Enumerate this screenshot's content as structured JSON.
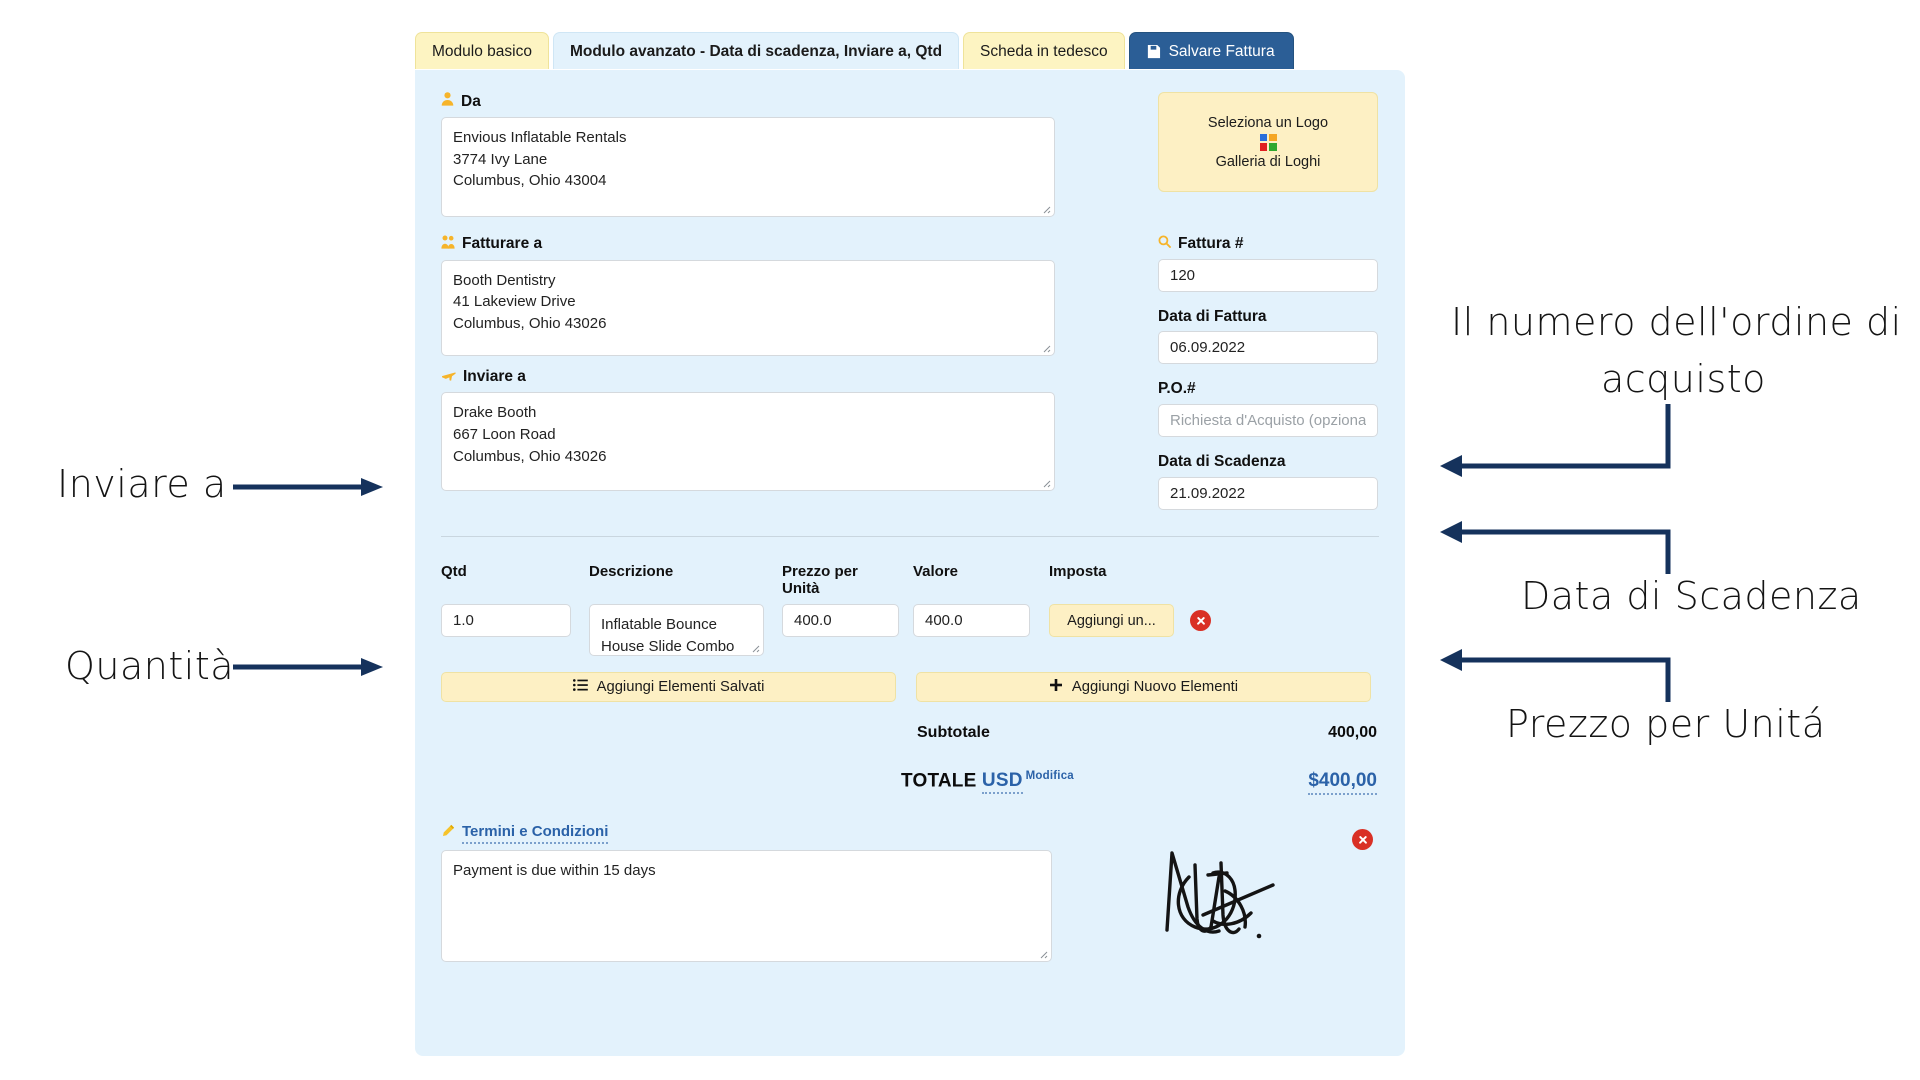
{
  "tabs": [
    {
      "label": "Modulo basico",
      "state": "inactive",
      "icon": null
    },
    {
      "label": "Modulo avanzato - Data di scadenza, Inviare a, Qtd",
      "state": "active",
      "icon": null
    },
    {
      "label": "Scheda in tedesco",
      "state": "inactive",
      "icon": null
    },
    {
      "label": "Salvare Fattura",
      "state": "primary",
      "icon": "save-disk-icon"
    }
  ],
  "form": {
    "from": {
      "icon": "person-icon",
      "label": "Da",
      "value": "Envious Inflatable Rentals\n3774 Ivy Lane\nColumbus, Ohio 43004"
    },
    "bill_to": {
      "icon": "people-icon",
      "label": "Fatturare a",
      "value": "Booth Dentistry\n41 Lakeview Drive\nColumbus, Ohio 43026"
    },
    "ship_to": {
      "icon": "airplane-icon",
      "label": "Inviare a",
      "value": "Drake Booth\n667 Loon Road\nColumbus, Ohio 43026"
    },
    "logo": {
      "title": "Seleziona un Logo",
      "subtitle": "Galleria di Loghi",
      "icon": "logo-gallery-grid-icon",
      "swatches": [
        "#2a6fdb",
        "#f5a623",
        "#e02020",
        "#2fa82f"
      ]
    },
    "invoice_number": {
      "icon": "magnifier-icon",
      "label": "Fattura #",
      "value": "120"
    },
    "invoice_date": {
      "label": "Data di Fattura",
      "value": "06.09.2022"
    },
    "po_number": {
      "label": "P.O.#",
      "value": "",
      "placeholder": "Richiesta d'Acquisto (opzionale)"
    },
    "due_date": {
      "label": "Data di Scadenza",
      "value": "21.09.2022"
    }
  },
  "items": {
    "columns": [
      "Qtd",
      "Descrizione",
      "Prezzo per Unità",
      "Valore",
      "Imposta"
    ],
    "rows": [
      {
        "qty": "1.0",
        "description": "Inflatable Bounce House Slide Combo",
        "unit_price": "400.0",
        "value": "400.0",
        "tax_button": "Aggiungi un...",
        "delete_icon": "delete-circle-icon"
      }
    ],
    "add_saved_button": {
      "label": "Aggiungi Elementi Salvati",
      "icon": "list-icon"
    },
    "add_new_button": {
      "label": "Aggiungi Nuovo Elementi",
      "icon": "plus-icon"
    }
  },
  "totals": {
    "subtotal_label": "Subtotale",
    "subtotal_value": "400,00",
    "total_label": "TOTALE",
    "currency": "USD",
    "edit_label": "Modifica",
    "total_value": "$400,00"
  },
  "terms": {
    "icon": "pencil-icon",
    "link_label": "Termini e Condizioni",
    "value": "Payment is due within 15 days"
  },
  "signature": {
    "icon": "signature-scribble",
    "delete_icon": "delete-circle-icon"
  },
  "annotations": [
    {
      "text": "Inviare a",
      "id": "annotation-ship-to"
    },
    {
      "text": "Quantità",
      "id": "annotation-quantity"
    },
    {
      "text": "Il numero dell'ordine di",
      "id": "annotation-po-line1"
    },
    {
      "text": "acquisto",
      "id": "annotation-po-line2"
    },
    {
      "text": "Data di Scadenza",
      "id": "annotation-due-date"
    },
    {
      "text": "Prezzo per Unitá",
      "id": "annotation-unit-price"
    }
  ],
  "colors": {
    "panel_bg": "#e3f2fc",
    "tab_yellow": "#fdf4c2",
    "tab_primary": "#2b5e96",
    "accent_blue": "#2b62a8",
    "danger_red": "#d93025",
    "annotation_navy": "#15325c"
  }
}
